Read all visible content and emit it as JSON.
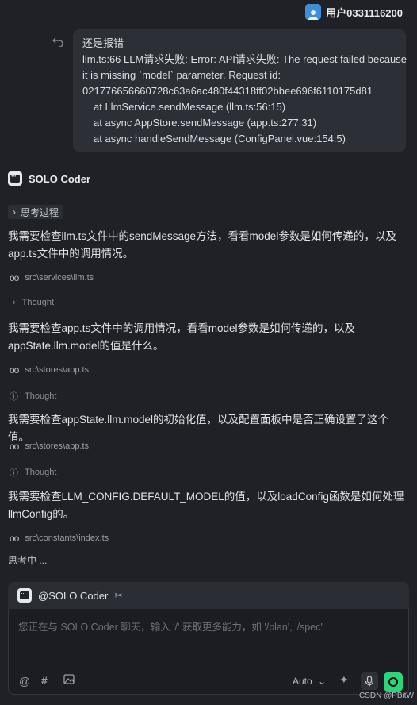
{
  "header": {
    "username": "用户0331116200"
  },
  "user_message": {
    "lines": [
      "还是报错",
      "llm.ts:66 LLM请求失败: Error: API请求失败: The request failed because",
      "it is missing `model` parameter. Request id:",
      "021776656660728c63a6ac480f44318ff02bbee696f6110175d81",
      "at LlmService.sendMessage (llm.ts:56:15)",
      "at async AppStore.sendMessage (app.ts:277:31)",
      "at async handleSendMessage (ConfigPanel.vue:154:5)"
    ]
  },
  "agent": {
    "name": "SOLO Coder",
    "thinking_process_label": "思考过程",
    "steps": [
      {
        "text": "我需要检查llm.ts文件中的sendMessage方法，看看model参数是如何传递的，以及app.ts文件中的调用情况。",
        "file": "src\\services\\llm.ts",
        "thought": "Thought"
      },
      {
        "text": "我需要检查app.ts文件中的调用情况，看看model参数是如何传递的，以及appState.llm.model的值是什么。",
        "file": "src\\stores\\app.ts",
        "thought": "Thought"
      },
      {
        "text": "我需要检查appState.llm.model的初始化值，以及配置面板中是否正确设置了这个值。",
        "file": "src\\stores\\app.ts",
        "thought": "Thought"
      },
      {
        "text": "我需要检查LLM_CONFIG.DEFAULT_MODEL的值，以及loadConfig函数是如何处理llmConfig的。",
        "file": "src\\constants\\index.ts"
      }
    ],
    "status": "思考中 ..."
  },
  "composer": {
    "mention": "@SOLO Coder",
    "placeholder": "您正在与 SOLO Coder 聊天，输入 '/' 获取更多能力，如 '/plan', '/spec'",
    "model_select": "Auto",
    "icons": [
      "at-icon",
      "hash-icon",
      "image-icon",
      "sparkle-icon",
      "mic-icon",
      "send-icon"
    ]
  },
  "watermark": "CSDN @PBitW",
  "colors": {
    "accent": "#2fd37b",
    "avatar": "#3c8ed9",
    "background": "#1f2126"
  }
}
